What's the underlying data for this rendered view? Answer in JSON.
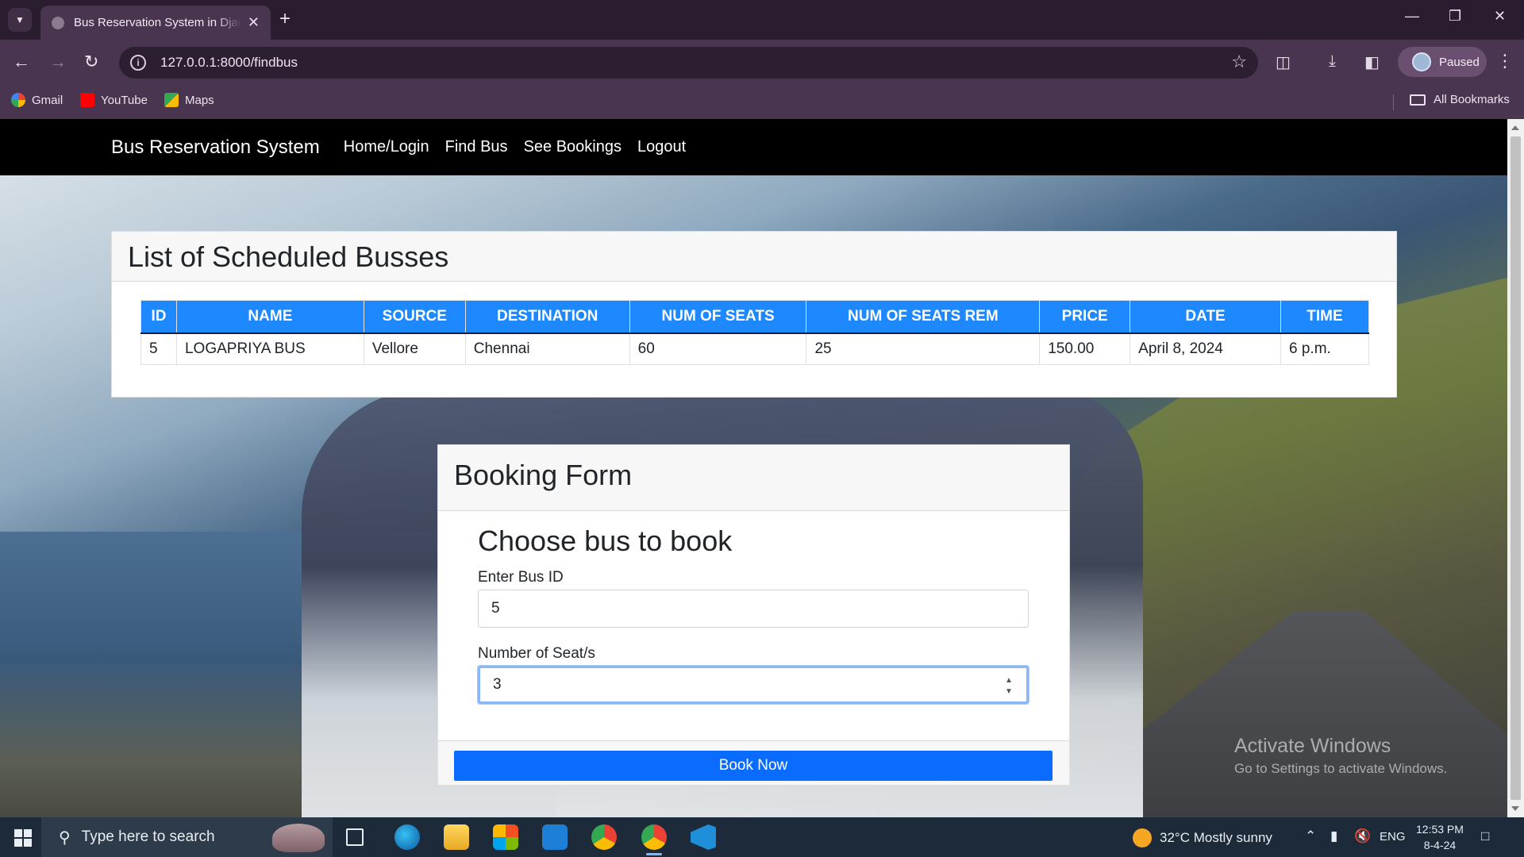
{
  "browser": {
    "tab_title": "Bus Reservation System in Django",
    "url": "127.0.0.1:8000/findbus",
    "profile_label": "Paused",
    "bookmarks": [
      "Gmail",
      "YouTube",
      "Maps"
    ],
    "all_bookmarks": "All Bookmarks"
  },
  "navbar": {
    "brand": "Bus Reservation System",
    "links": [
      "Home/Login",
      "Find Bus",
      "See Bookings",
      "Logout"
    ]
  },
  "schedule": {
    "title": "List of Scheduled Busses",
    "columns": [
      "ID",
      "NAME",
      "SOURCE",
      "DESTINATION",
      "NUM OF SEATS",
      "NUM OF SEATS REM",
      "PRICE",
      "DATE",
      "TIME"
    ],
    "rows": [
      [
        "5",
        "LOGAPRIYA BUS",
        "Vellore",
        "Chennai",
        "60",
        "25",
        "150.00",
        "April 8, 2024",
        "6 p.m."
      ]
    ]
  },
  "booking": {
    "header": "Booking Form",
    "heading": "Choose bus to book",
    "bus_id_label": "Enter Bus ID",
    "bus_id_value": "5",
    "seats_label": "Number of Seat/s",
    "seats_value": "3",
    "submit_label": "Book Now"
  },
  "watermark": {
    "line1": "Activate Windows",
    "line2": "Go to Settings to activate Windows."
  },
  "taskbar": {
    "search_placeholder": "Type here to search",
    "weather": "32°C  Mostly sunny",
    "language": "ENG",
    "time": "12:53 PM",
    "date": "8-4-24"
  },
  "colors": {
    "table_header": "#1e88ff",
    "primary_button": "#0a6cff",
    "navbar": "#000000",
    "browser_frame": "#4a3550"
  }
}
